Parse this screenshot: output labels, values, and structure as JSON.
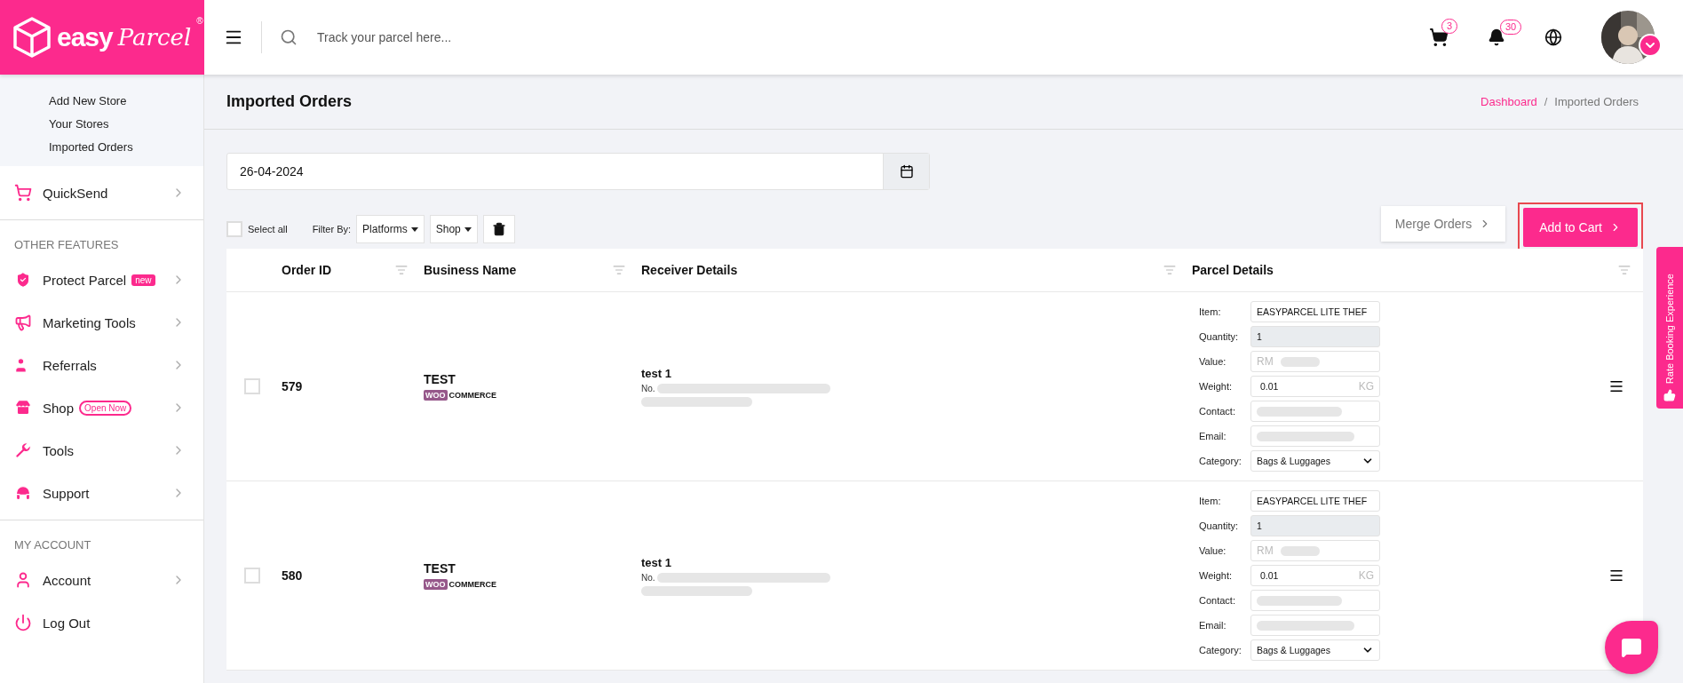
{
  "logo": {
    "word1": "easy",
    "word2": "Parcel",
    "mark": "®"
  },
  "header": {
    "search_placeholder": "Track your parcel here...",
    "cart_count": "3",
    "notification_count": "30"
  },
  "sidebar": {
    "submenu": [
      {
        "label": "Add New Store"
      },
      {
        "label": "Your Stores"
      },
      {
        "label": "Imported Orders"
      }
    ],
    "sections": [
      {
        "items": [
          {
            "label": "QuickSend"
          }
        ]
      },
      {
        "title": "OTHER FEATURES",
        "items": [
          {
            "label": "Protect Parcel",
            "badge": {
              "text": "new",
              "kind": "filled"
            }
          },
          {
            "label": "Marketing Tools"
          },
          {
            "label": "Referrals"
          },
          {
            "label": "Shop",
            "badge": {
              "text": "Open Now",
              "kind": "outline"
            }
          },
          {
            "label": "Tools"
          },
          {
            "label": "Support"
          }
        ]
      },
      {
        "title": "MY ACCOUNT",
        "items": [
          {
            "label": "Account"
          },
          {
            "label": "Log Out",
            "no_arrow": true
          }
        ]
      }
    ]
  },
  "page": {
    "title": "Imported Orders",
    "breadcrumb": [
      {
        "label": "Dashboard",
        "kind": "link"
      },
      {
        "label": "/",
        "kind": "sep"
      },
      {
        "label": "Imported Orders",
        "kind": "current"
      }
    ]
  },
  "date": "26-04-2024",
  "toolbar": {
    "select_all": {
      "label": "Select all",
      "checked": false
    },
    "filter_label": "Filter By:",
    "filters": [
      "Platforms",
      "Shop"
    ],
    "merge": "Merge Orders",
    "add": {
      "label": "Add to Cart",
      "highlighted": true
    }
  },
  "table": {
    "columns": [
      "Order ID",
      "Business Name",
      "Receiver Details",
      "Parcel Details"
    ],
    "rows": [
      {
        "checked": false,
        "order_id": "579",
        "business": "TEST",
        "platform": {
          "woo": "WOO",
          "commerce": "COMMERCE"
        },
        "receiver": "test 1",
        "address_start": "No.",
        "parcel": [
          {
            "label": "Item:",
            "kind": "text",
            "value": "EASYPARCEL LITE THEF"
          },
          {
            "label": "Quantity:",
            "kind": "readonly",
            "value": "1"
          },
          {
            "label": "Value:",
            "kind": "money",
            "prefix": "RM"
          },
          {
            "label": "Weight:",
            "kind": "weight",
            "value": "0.01",
            "unit": "KG"
          },
          {
            "label": "Contact:",
            "kind": "redacted"
          },
          {
            "label": "Email:",
            "kind": "redacted"
          },
          {
            "label": "Category:",
            "kind": "select",
            "value": "Bags & Luggages"
          }
        ]
      },
      {
        "checked": false,
        "order_id": "580",
        "business": "TEST",
        "platform": {
          "woo": "WOO",
          "commerce": "COMMERCE"
        },
        "receiver": "test 1",
        "address_start": "No.",
        "parcel": [
          {
            "label": "Item:",
            "kind": "text",
            "value": "EASYPARCEL LITE THEF"
          },
          {
            "label": "Quantity:",
            "kind": "readonly",
            "value": "1"
          },
          {
            "label": "Value:",
            "kind": "money",
            "prefix": "RM"
          },
          {
            "label": "Weight:",
            "kind": "weight",
            "value": "0.01",
            "unit": "KG"
          },
          {
            "label": "Contact:",
            "kind": "redacted"
          },
          {
            "label": "Email:",
            "kind": "redacted"
          },
          {
            "label": "Category:",
            "kind": "select",
            "value": "Bags & Luggages"
          }
        ]
      }
    ]
  },
  "rate_tab": "Rate Booking Experience"
}
